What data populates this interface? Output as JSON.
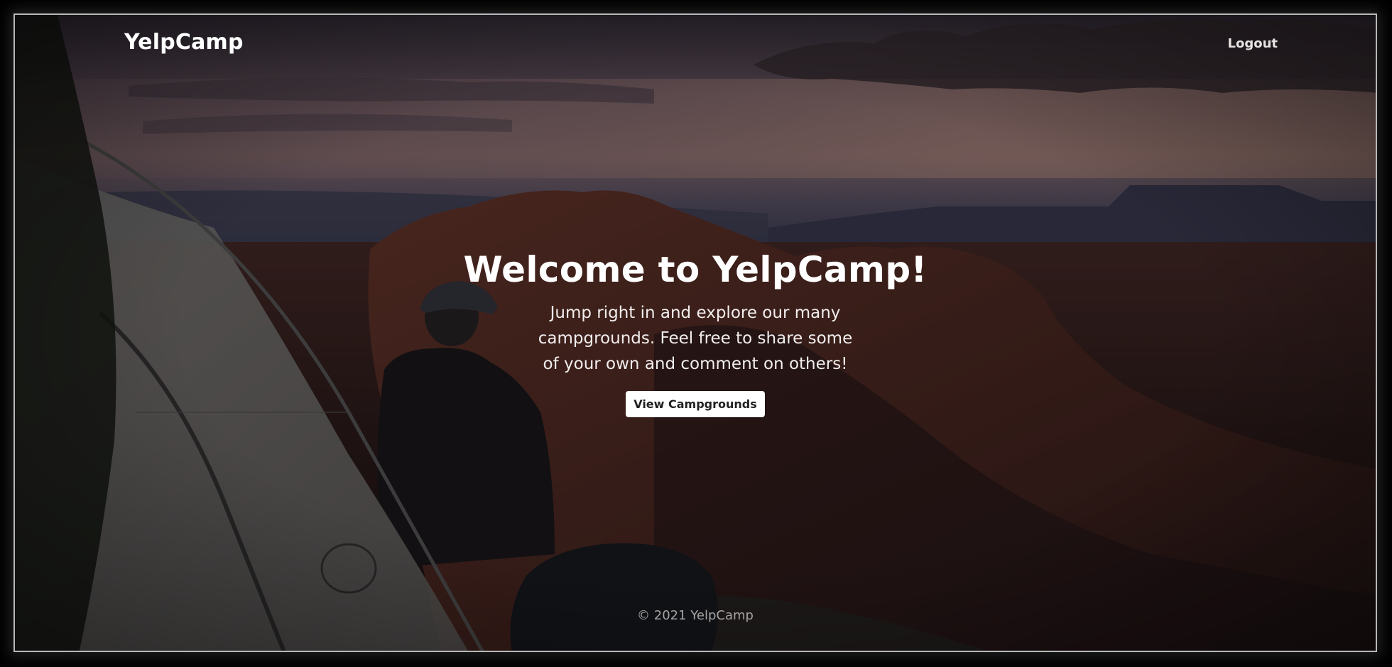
{
  "nav": {
    "brand": "YelpCamp",
    "logout_label": "Logout"
  },
  "hero": {
    "title": "Welcome to YelpCamp!",
    "subtitle": "Jump right in and explore our many campgrounds. Feel free to share some of your own and comment on others!",
    "button_label": "View Campgrounds"
  },
  "footer": {
    "text": "© 2021 YelpCamp"
  },
  "colors": {
    "text": "#ffffff",
    "button_bg": "#ffffff",
    "button_text": "#212121",
    "footer_text": "#a7a3a3"
  }
}
